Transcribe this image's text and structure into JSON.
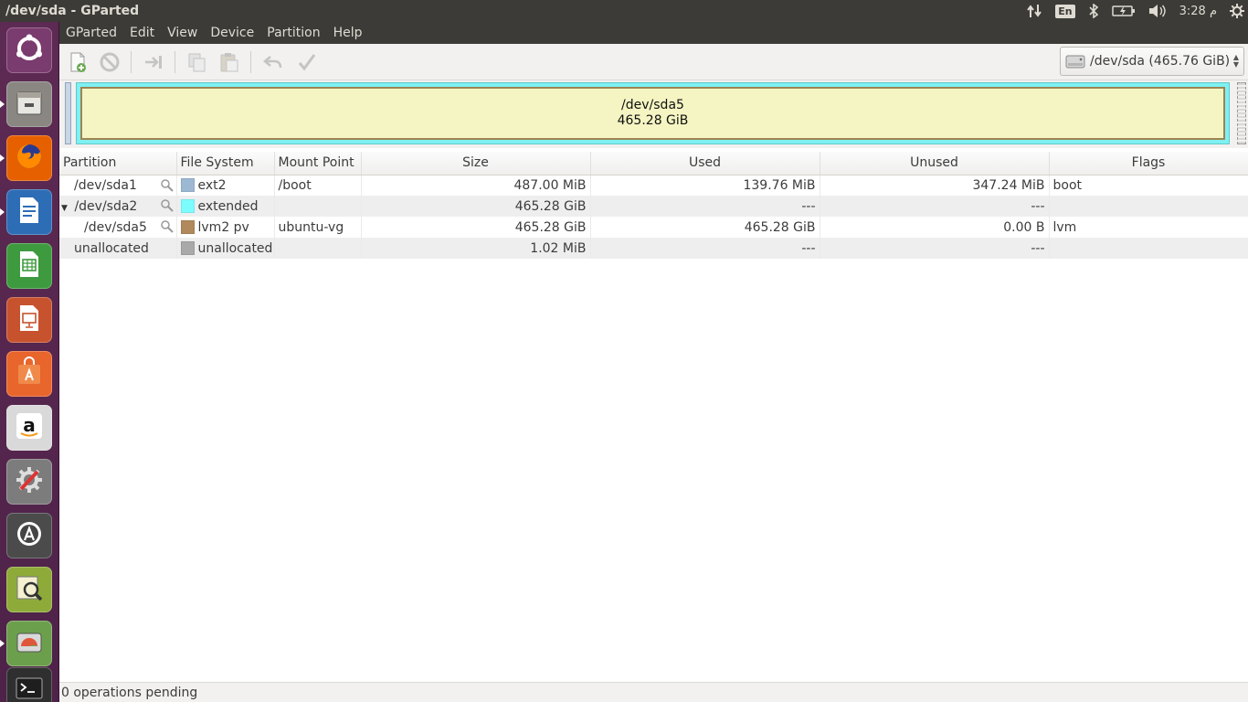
{
  "window": {
    "title": "/dev/sda - GParted"
  },
  "tray": {
    "lang": "En",
    "clock": "3:28 م"
  },
  "launcher": {
    "items": [
      {
        "name": "ubuntu-dash",
        "color": "#7a3b6e"
      },
      {
        "name": "files",
        "color": "#8a8782"
      },
      {
        "name": "firefox",
        "color": "#e66000"
      },
      {
        "name": "libreoffice-writer",
        "color": "#2d6db5"
      },
      {
        "name": "libreoffice-calc",
        "color": "#3e9a3e"
      },
      {
        "name": "libreoffice-impress",
        "color": "#c7532e"
      },
      {
        "name": "ubuntu-software",
        "color": "#e8652b"
      },
      {
        "name": "amazon",
        "color": "#d9d9d9"
      },
      {
        "name": "system-settings",
        "color": "#7c7c7c"
      },
      {
        "name": "software-updater",
        "color": "#4b4b4b"
      },
      {
        "name": "disk-usage-analyzer",
        "color": "#8eab3a"
      },
      {
        "name": "gparted",
        "color": "#6c9f4c"
      },
      {
        "name": "terminal",
        "color": "#2f2f2f"
      }
    ]
  },
  "menu": {
    "items": [
      "GParted",
      "Edit",
      "View",
      "Device",
      "Partition",
      "Help"
    ]
  },
  "toolbar": {
    "device_label": "/dev/sda  (465.76 GiB)"
  },
  "graph": {
    "partition_name": "/dev/sda5",
    "partition_size": "465.28 GiB"
  },
  "table": {
    "columns": [
      "Partition",
      "File System",
      "Mount Point",
      "Size",
      "Used",
      "Unused",
      "Flags"
    ],
    "rows": [
      {
        "partition": "/dev/sda1",
        "filesystem": "ext2",
        "fs_color": "#9db8d2",
        "mount": "/boot",
        "size": "487.00 MiB",
        "used": "139.76 MiB",
        "unused": "347.24 MiB",
        "flags": "boot"
      },
      {
        "partition": "/dev/sda2",
        "filesystem": "extended",
        "fs_color": "#7dfcfe",
        "mount": "",
        "size": "465.28 GiB",
        "used": "---",
        "unused": "---",
        "flags": ""
      },
      {
        "partition": "/dev/sda5",
        "filesystem": "lvm2 pv",
        "fs_color": "#b1895c",
        "mount": "ubuntu-vg",
        "size": "465.28 GiB",
        "used": "465.28 GiB",
        "unused": "0.00 B",
        "flags": "lvm"
      },
      {
        "partition": "unallocated",
        "filesystem": "unallocated",
        "fs_color": "#a9a9a9",
        "mount": "",
        "size": "1.02 MiB",
        "used": "---",
        "unused": "---",
        "flags": ""
      }
    ]
  },
  "status": {
    "text": "0 operations pending"
  }
}
